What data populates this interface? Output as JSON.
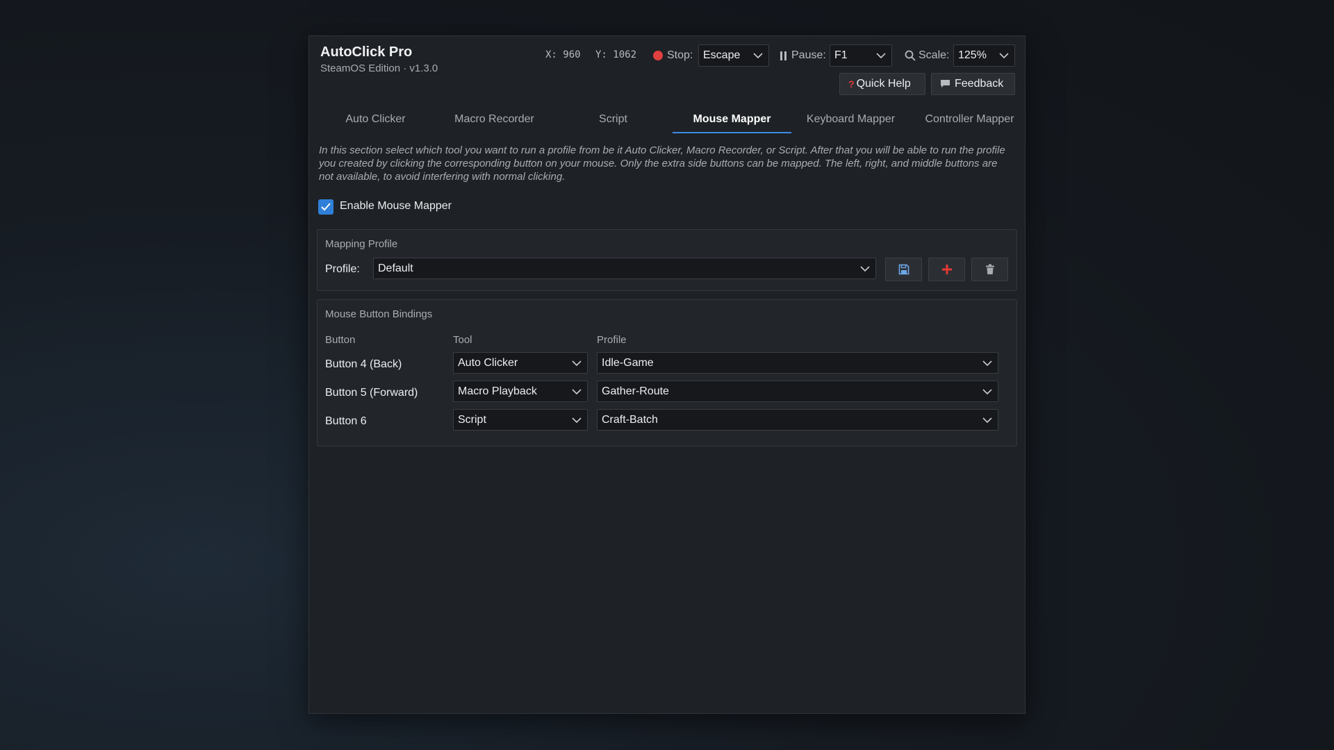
{
  "app": {
    "title": "AutoClick Pro",
    "subtitle": "SteamOS Edition · v1.3.0"
  },
  "toolbar": {
    "x_readout": "X: 960",
    "y_readout": "Y: 1062",
    "stop_label": "Stop:",
    "stop_value": "Escape",
    "pause_label": "Pause:",
    "pause_value": "F1",
    "scale_label": "Scale:",
    "scale_value": "125%",
    "quick_help_label": "Quick Help",
    "feedback_label": "Feedback",
    "stop_indicator_color": "#e04040",
    "help_icon_color": "#e53935"
  },
  "tabs": [
    {
      "label": "Auto Clicker",
      "active": false
    },
    {
      "label": "Macro Recorder",
      "active": false
    },
    {
      "label": "Script",
      "active": false
    },
    {
      "label": "Mouse Mapper",
      "active": true
    },
    {
      "label": "Keyboard Mapper",
      "active": false
    },
    {
      "label": "Controller Mapper",
      "active": false
    }
  ],
  "main": {
    "description": "In this section select which tool you want to run a profile from be it Auto Clicker, Macro Recorder, or Script. After that you will be able to run the profile you created by clicking the corresponding button on your mouse. Only the extra side buttons can be mapped. The left, right, and middle buttons are not available, to avoid interfering with normal clicking.",
    "enable_label": "Enable Mouse Mapper",
    "enable_checked": true,
    "accent_color": "#2f7fd9"
  },
  "mapping_profile": {
    "group_title": "Mapping Profile",
    "profile_label": "Profile:",
    "profile_value": "Default",
    "save_icon": "floppy-disk-icon",
    "add_icon": "plus-icon",
    "delete_icon": "trash-icon",
    "add_icon_color": "#e53935"
  },
  "bindings": {
    "group_title": "Mouse Button Bindings",
    "headers": {
      "button": "Button",
      "tool": "Tool",
      "profile": "Profile"
    },
    "rows": [
      {
        "button": "Button 4 (Back)",
        "tool": "Auto Clicker",
        "profile": "Idle-Game"
      },
      {
        "button": "Button 5 (Forward)",
        "tool": "Macro Playback",
        "profile": "Gather-Route"
      },
      {
        "button": "Button 6",
        "tool": "Script",
        "profile": "Craft-Batch"
      }
    ]
  }
}
